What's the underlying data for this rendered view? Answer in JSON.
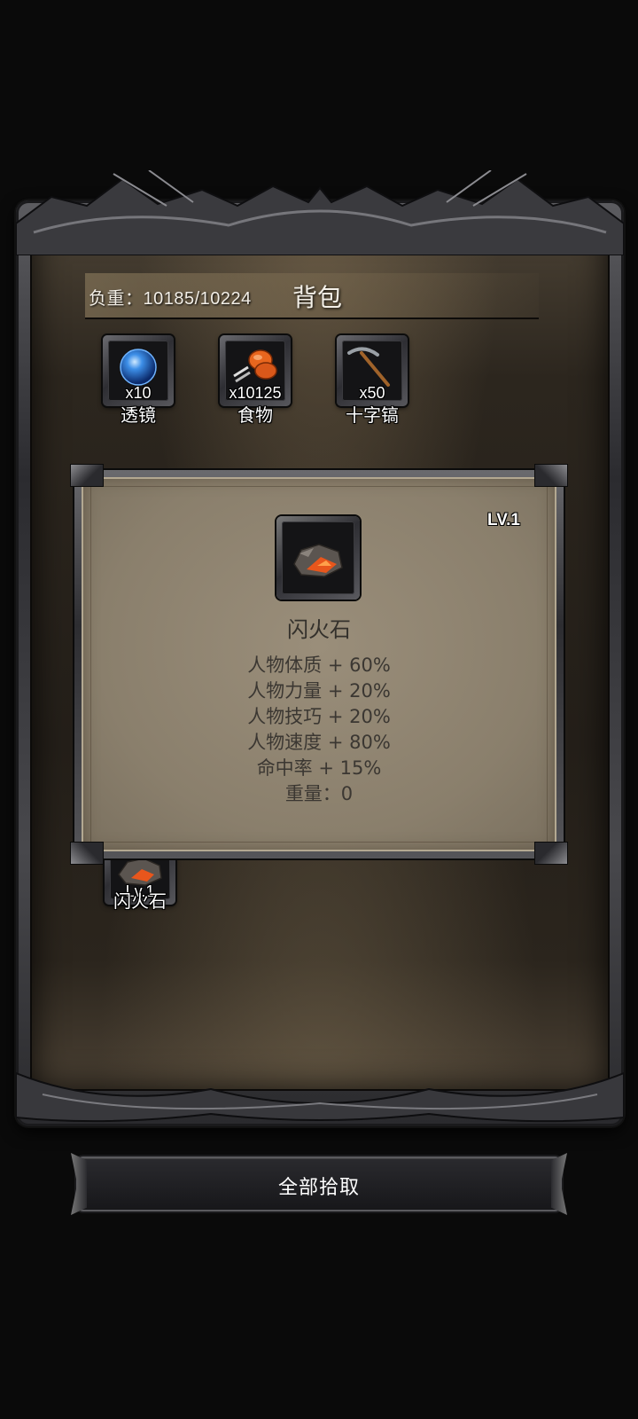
{
  "header": {
    "load_label": "负重：10185/10224",
    "title": "背包"
  },
  "inventory": {
    "items": [
      {
        "name": "透镜",
        "count": "x10",
        "icon": "blue-orb-icon"
      },
      {
        "name": "食物",
        "count": "x10125",
        "icon": "meat-drumstick-icon"
      },
      {
        "name": "十字镐",
        "count": "x50",
        "icon": "pickaxe-icon"
      }
    ]
  },
  "popup": {
    "level": "LV.1",
    "item_name": "闪火石",
    "item_icon": "flint-stone-icon",
    "stats": [
      "人物体质 + 60%",
      "人物力量 + 20%",
      "人物技巧 + 20%",
      "人物速度 + 80%",
      "命中率 + 15%",
      "重量：0"
    ]
  },
  "grid_item": {
    "level": "Lv.1",
    "name": "闪火石",
    "icon": "flint-stone-icon"
  },
  "footer": {
    "pickup_all_label": "全部拾取"
  },
  "colors": {
    "panel_parchment": "#8a7f6c",
    "frame_metal": "#4a4a4e",
    "background": "#0a0a0a",
    "stone_glow": "#e8561c"
  }
}
